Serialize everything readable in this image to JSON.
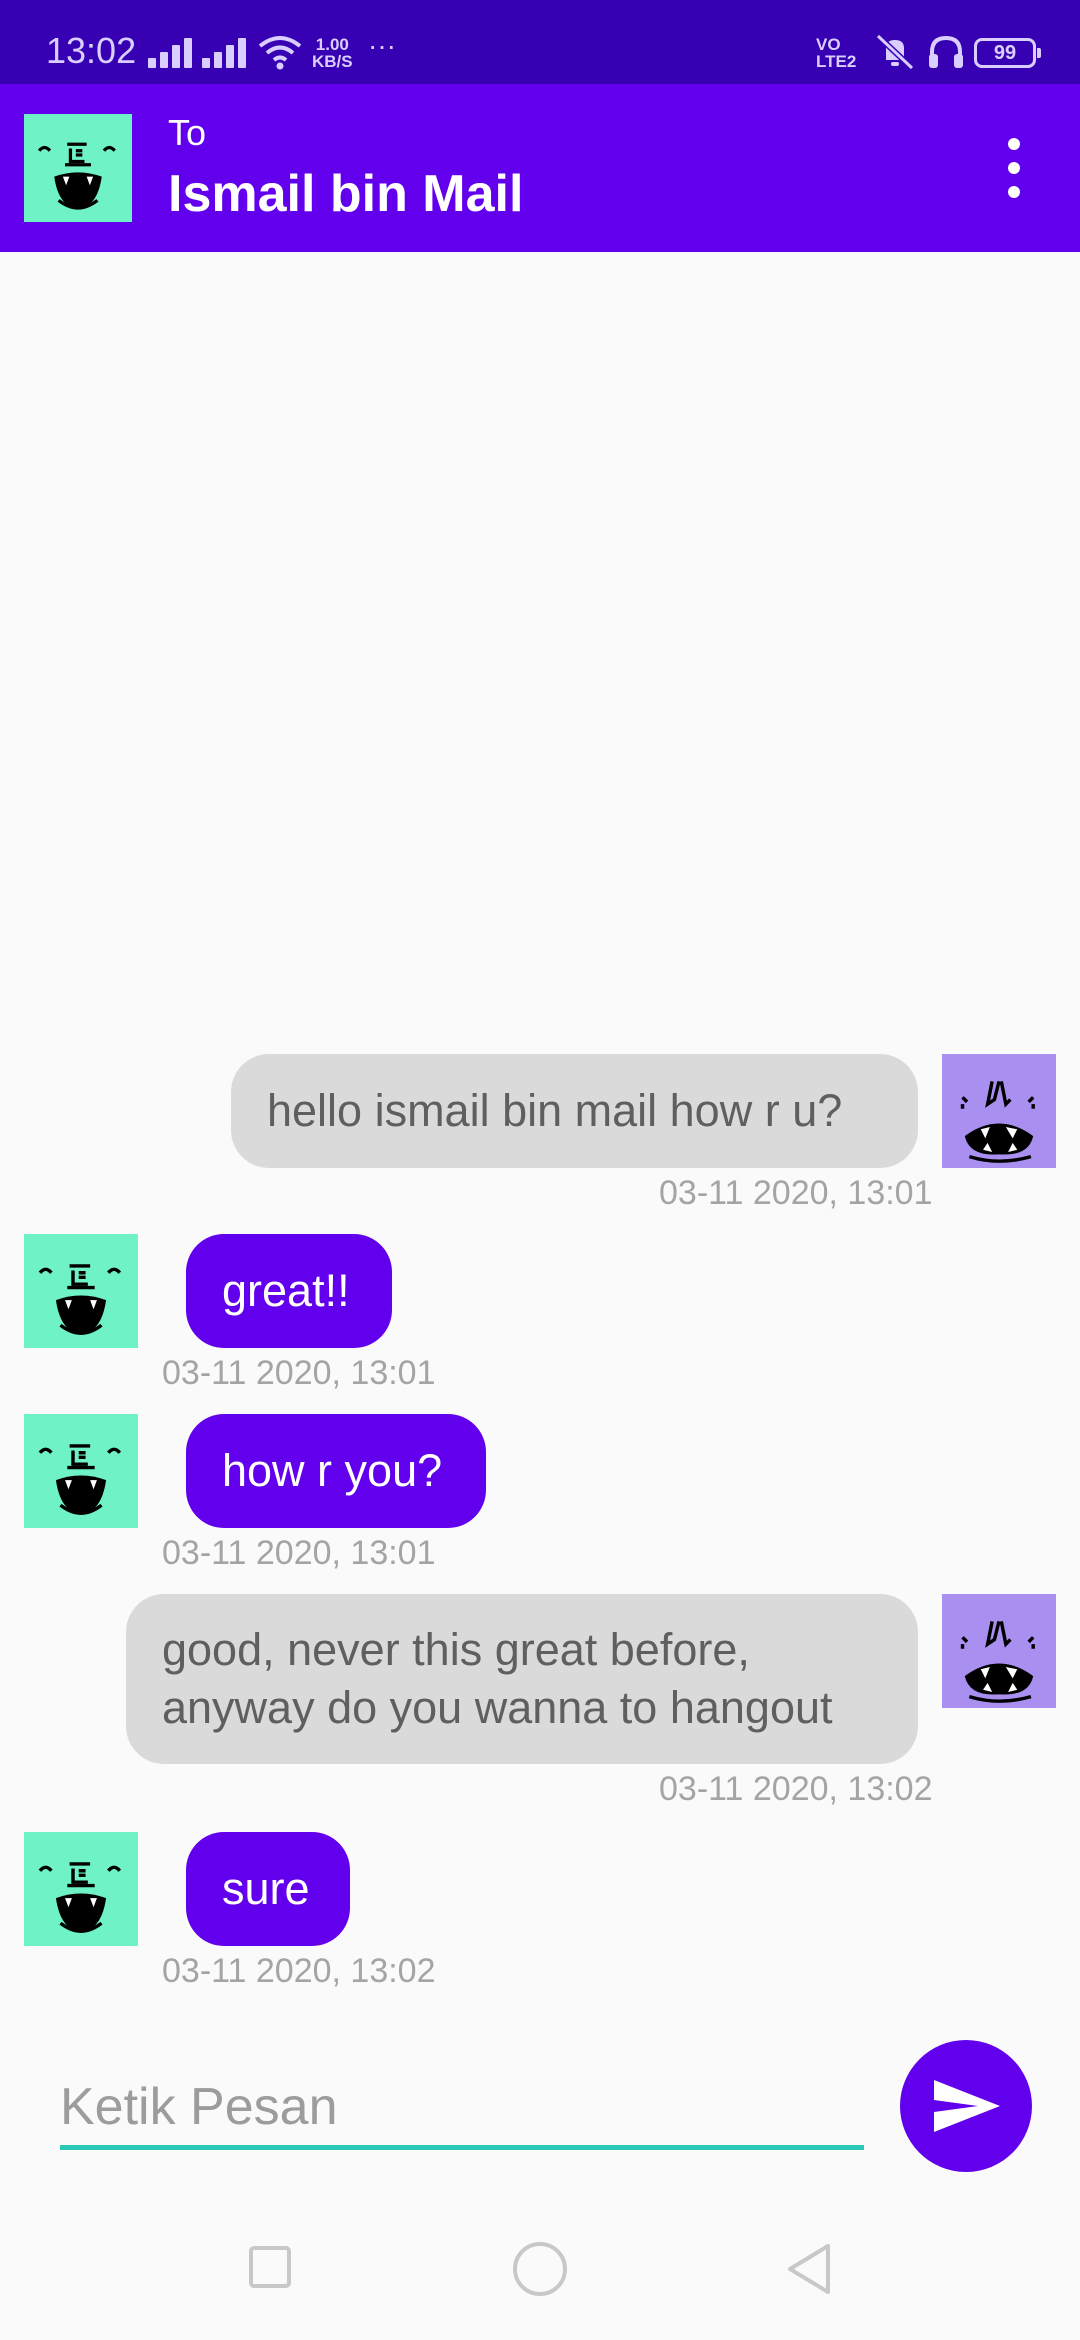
{
  "status_bar": {
    "time": "13:02",
    "speed_value": "1.00",
    "speed_unit": "KB/S",
    "more": "···",
    "volte_top": "VO",
    "volte_bottom": "LTE2",
    "battery": "99"
  },
  "header": {
    "to_label": "To",
    "contact_name": "Ismail bin Mail",
    "menu_icon": "more-vert-icon"
  },
  "messages": [
    {
      "direction": "sent",
      "text": "hello ismail bin mail how r u?",
      "time": "03-11 2020, 13:01"
    },
    {
      "direction": "received",
      "text": "great!!",
      "time": "03-11 2020, 13:01"
    },
    {
      "direction": "received",
      "text": "how r you?",
      "time": "03-11 2020, 13:01"
    },
    {
      "direction": "sent",
      "text_line1": "good, never this great before,",
      "text_line2": "anyway do you wanna to hangout",
      "time": "03-11 2020, 13:02"
    },
    {
      "direction": "received",
      "text": "sure",
      "time": "03-11 2020, 13:02"
    }
  ],
  "composer": {
    "placeholder": "Ketik Pesan",
    "value": "",
    "send_icon": "send-icon"
  },
  "colors": {
    "status_bar": "#3700b3",
    "app_bar": "#6200ee",
    "received_bubble": "#6200ee",
    "sent_bubble": "#dadada",
    "input_underline": "#2ac9b7",
    "contact_avatar_bg": "#6ef2c6",
    "self_avatar_bg": "#a98ff0"
  }
}
